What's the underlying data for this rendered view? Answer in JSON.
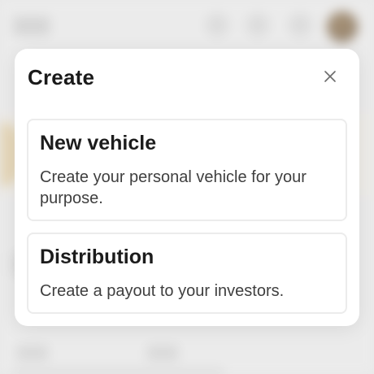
{
  "modal": {
    "title": "Create",
    "close_icon": "close-icon",
    "options": [
      {
        "title": "New vehicle",
        "description": "Create your personal vehicle for your purpose."
      },
      {
        "title": "Distribution",
        "description": "Create a payout to your investors."
      }
    ]
  },
  "colors": {
    "modal_background": "#ffffff",
    "card_border": "#ececec",
    "title_text": "#1a1a1a",
    "body_text": "#3f3f3f",
    "backdrop": "#efefef"
  }
}
